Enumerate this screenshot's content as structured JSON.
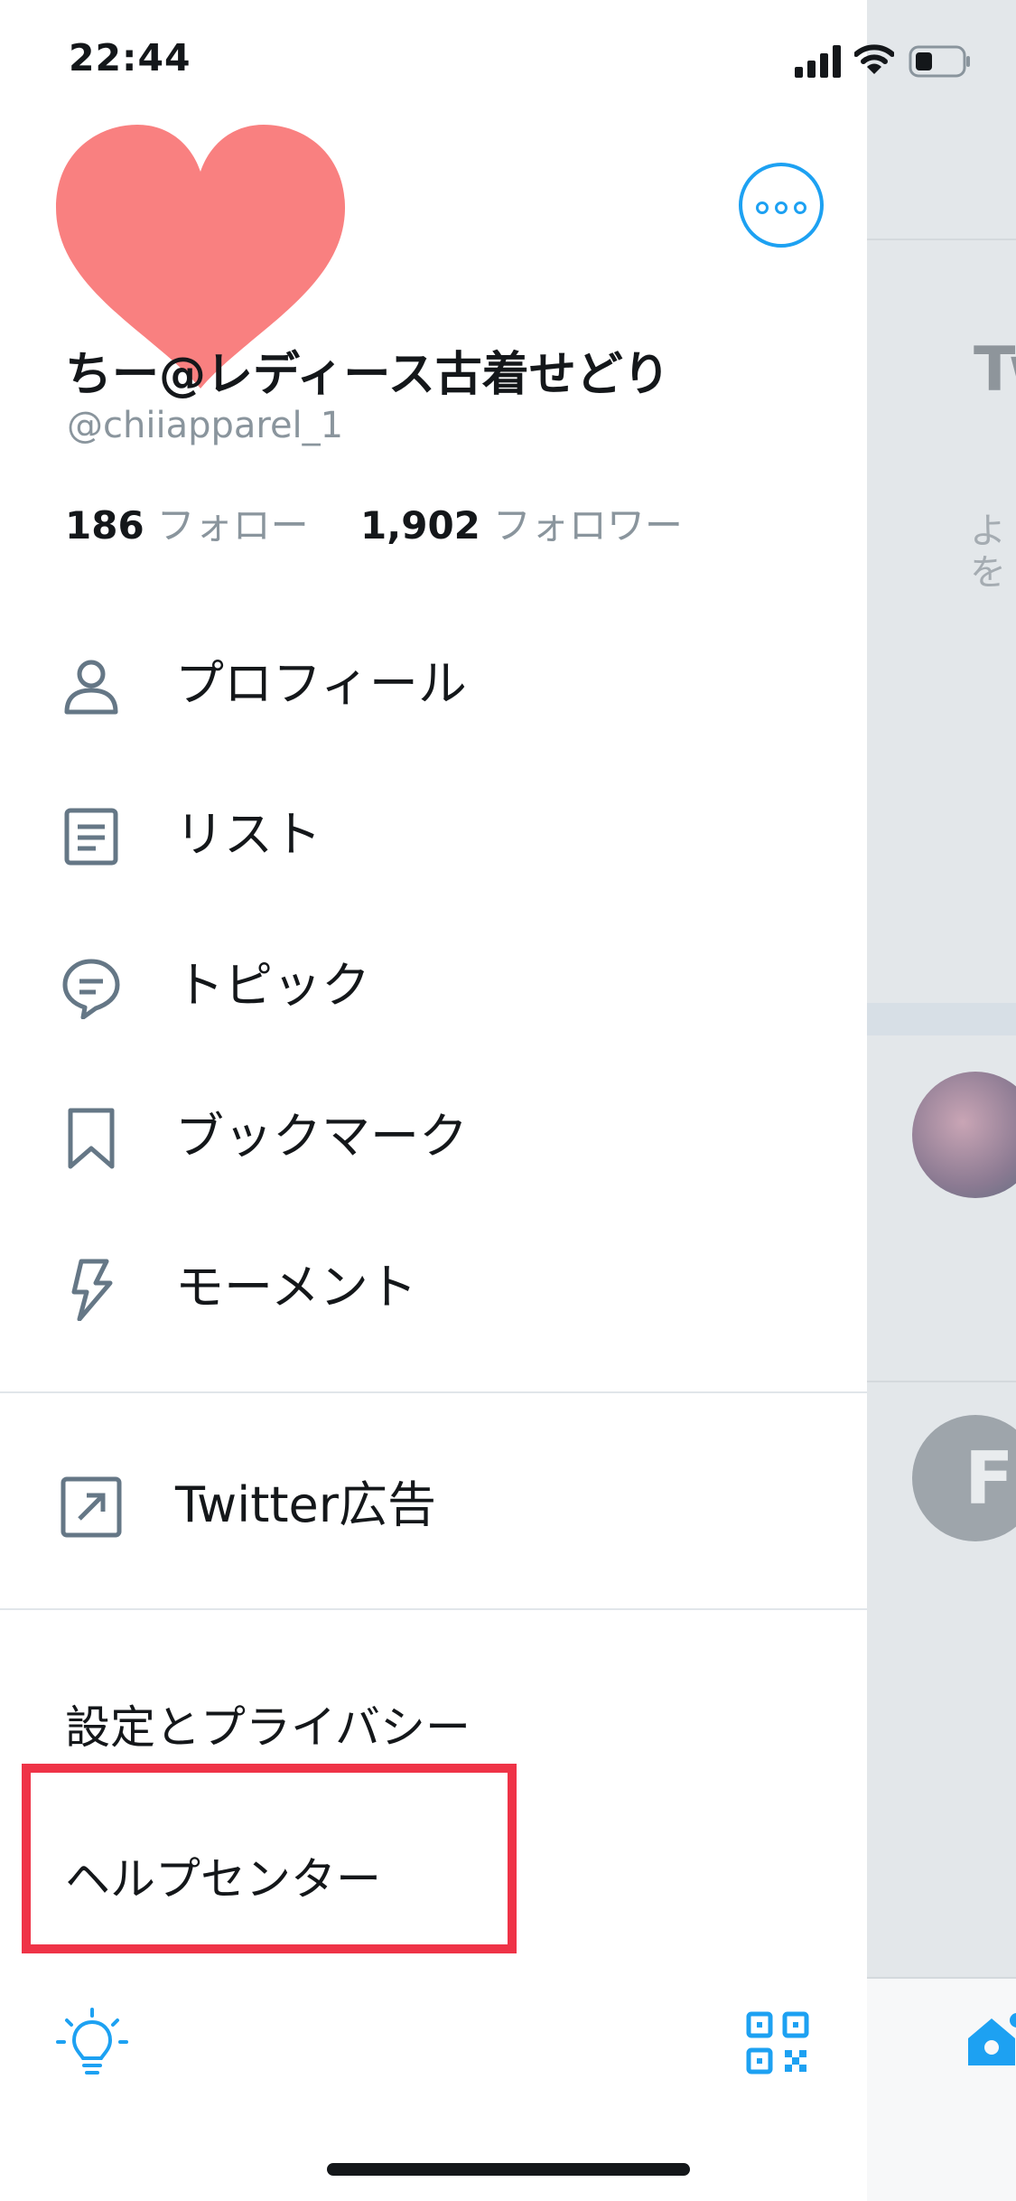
{
  "status": {
    "time": "22:44"
  },
  "profile": {
    "name": "ちー@レディース古着せどり",
    "handle": "@chiiapparel_1",
    "following_count": "186",
    "following_label": "フォロー",
    "followers_count": "1,902",
    "followers_label": "フォロワー"
  },
  "menu": [
    {
      "label": "プロフィール",
      "icon": "person-icon"
    },
    {
      "label": "リスト",
      "icon": "list-icon"
    },
    {
      "label": "トピック",
      "icon": "topic-icon"
    },
    {
      "label": "ブックマーク",
      "icon": "bookmark-icon"
    },
    {
      "label": "モーメント",
      "icon": "lightning-icon"
    }
  ],
  "ads": {
    "label": "Twitter広告",
    "icon": "external-link-icon"
  },
  "settings": {
    "label": "設定とプライバシー"
  },
  "help": {
    "label": "ヘルプセンター"
  },
  "footer": {
    "left_icon": "lightbulb-icon",
    "right_icon": "qr-code-icon"
  },
  "behind": {
    "title_fragment": "Tw",
    "hint_fragment": "よを"
  },
  "colors": {
    "accent": "#1da1f2",
    "highlight": "#ef3347",
    "heart": "#f98080",
    "secondary_text": "#8a959d"
  }
}
